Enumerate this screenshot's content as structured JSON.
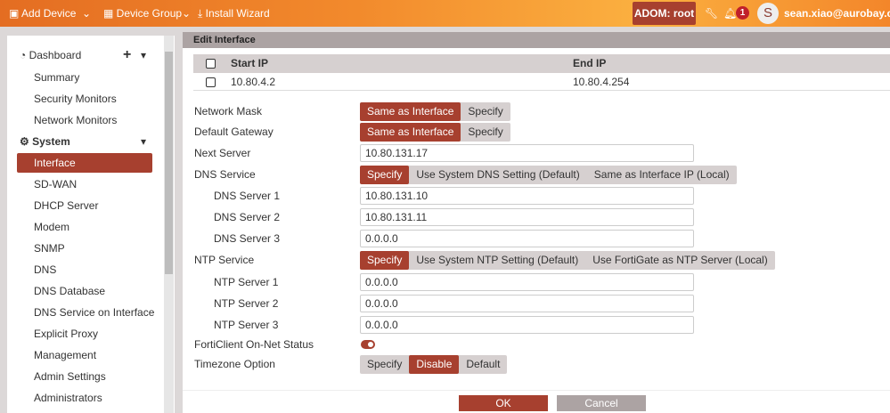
{
  "topbar": {
    "add_device": "Add Device",
    "device_group": "Device Group",
    "install_wizard": "Install Wizard",
    "adom": "ADOM: root",
    "notifications": "1",
    "avatar_initial": "S",
    "user": "sean.xiao@aurobay.com"
  },
  "sidebar": {
    "items": [
      {
        "label": "Dashboard",
        "type": "header"
      },
      {
        "label": "Summary"
      },
      {
        "label": "Security Monitors"
      },
      {
        "label": "Network Monitors"
      },
      {
        "label": "System",
        "type": "header"
      },
      {
        "label": "Interface",
        "active": true
      },
      {
        "label": "SD-WAN"
      },
      {
        "label": "DHCP Server"
      },
      {
        "label": "Modem"
      },
      {
        "label": "SNMP"
      },
      {
        "label": "DNS"
      },
      {
        "label": "DNS Database"
      },
      {
        "label": "DNS Service on Interface"
      },
      {
        "label": "Explicit Proxy"
      },
      {
        "label": "Management"
      },
      {
        "label": "Admin Settings"
      },
      {
        "label": "Administrators"
      }
    ]
  },
  "panel": {
    "title": "Edit Interface"
  },
  "ip_table": {
    "headers": [
      "Start IP",
      "End IP"
    ],
    "rows": [
      [
        "10.80.4.2",
        "10.80.4.254"
      ]
    ]
  },
  "form": {
    "network_mask": {
      "label": "Network Mask",
      "options": [
        "Same as Interface",
        "Specify"
      ],
      "selected": "Same as Interface"
    },
    "default_gateway": {
      "label": "Default Gateway",
      "options": [
        "Same as Interface",
        "Specify"
      ],
      "selected": "Same as Interface"
    },
    "next_server": {
      "label": "Next Server",
      "value": "10.80.131.17"
    },
    "dns_service": {
      "label": "DNS Service",
      "options": [
        "Specify",
        "Use System DNS Setting (Default)",
        "Same as Interface IP (Local)"
      ],
      "selected": "Specify"
    },
    "dns1": {
      "label": "DNS Server 1",
      "value": "10.80.131.10"
    },
    "dns2": {
      "label": "DNS Server 2",
      "value": "10.80.131.11"
    },
    "dns3": {
      "label": "DNS Server 3",
      "value": "0.0.0.0"
    },
    "ntp_service": {
      "label": "NTP Service",
      "options": [
        "Specify",
        "Use System NTP Setting (Default)",
        "Use FortiGate as NTP Server (Local)"
      ],
      "selected": "Specify"
    },
    "ntp1": {
      "label": "NTP Server 1",
      "value": "0.0.0.0"
    },
    "ntp2": {
      "label": "NTP Server 2",
      "value": "0.0.0.0"
    },
    "ntp3": {
      "label": "NTP Server 3",
      "value": "0.0.0.0"
    },
    "forticlient": {
      "label": "FortiClient On-Net Status",
      "enabled": true
    },
    "timezone": {
      "label": "Timezone Option",
      "options": [
        "Specify",
        "Disable",
        "Default"
      ],
      "selected": "Disable"
    }
  },
  "buttons": {
    "ok": "OK",
    "cancel": "Cancel"
  },
  "colors": {
    "accent": "#a7402f",
    "header_bar": "#aca3a3"
  }
}
